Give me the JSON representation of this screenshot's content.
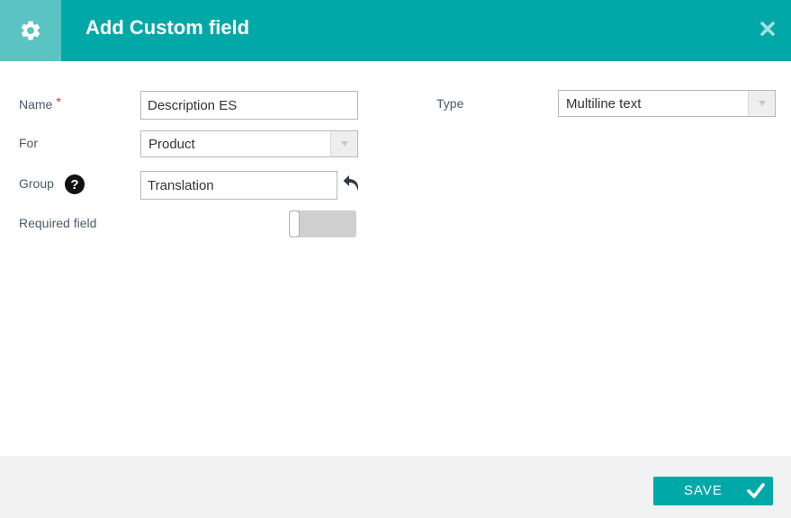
{
  "dialog": {
    "title": "Add Custom field",
    "header_icon": "gear-icon",
    "close_icon": "close-icon"
  },
  "fields": {
    "name": {
      "label": "Name",
      "required_marker": "*",
      "value": "Description ES"
    },
    "for": {
      "label": "For",
      "value": "Product"
    },
    "group": {
      "label": "Group",
      "help_icon": "question-icon",
      "help_glyph": "?",
      "value": "Translation",
      "reset_icon": "undo-icon"
    },
    "required": {
      "label": "Required field",
      "state": "off"
    },
    "type": {
      "label": "Type",
      "value": "Multiline text"
    }
  },
  "footer": {
    "save_label": "SAVE",
    "save_icon": "checkmark-icon"
  },
  "colors": {
    "header": "#00a9a8",
    "header_icon_box": "#5bc4c3",
    "required_star": "#e03030",
    "footer_bg": "#f2f2f2"
  }
}
